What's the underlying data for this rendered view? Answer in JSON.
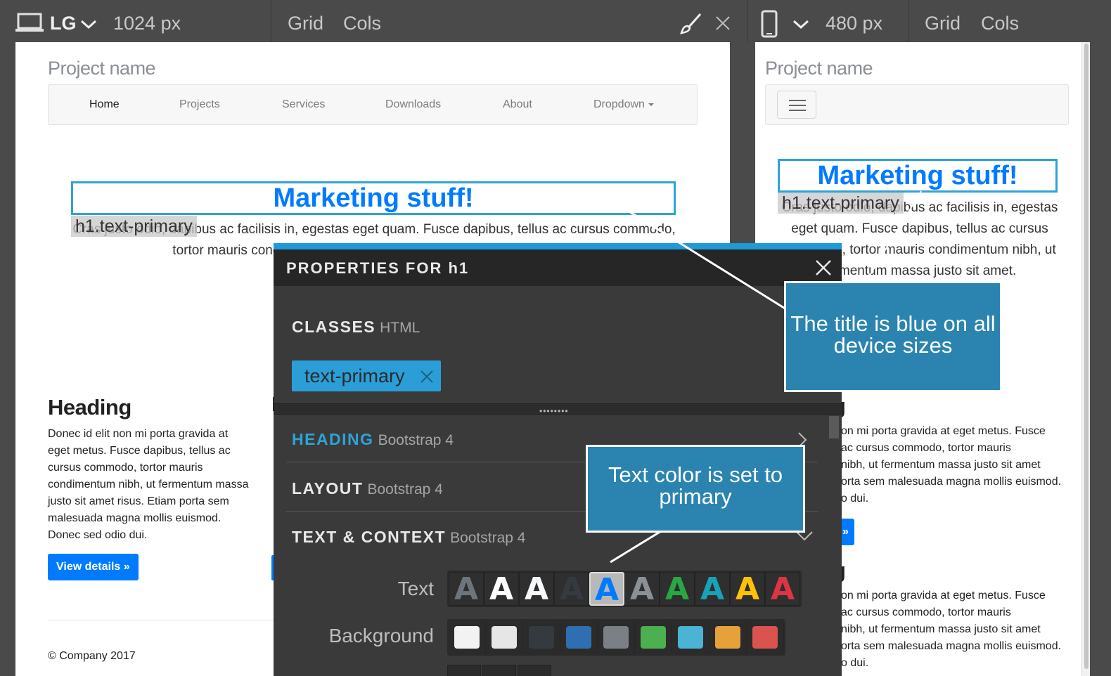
{
  "toolbar": {
    "left_device": "LG",
    "left_width": "1024 px",
    "left_grid": "Grid",
    "left_cols": "Cols",
    "right_width": "480 px",
    "right_grid": "Grid",
    "right_cols": "Cols"
  },
  "site": {
    "project_name": "Project name",
    "nav": [
      "Home",
      "Projects",
      "Services",
      "Downloads",
      "About",
      "Dropdown"
    ],
    "h1": "Marketing stuff!",
    "h1_tag": "h1.text-primary",
    "lead_left_line1": "Cras justo odio, dapibus ac facilisis in, egestas eget quam. Fusce dapibus, tellus ac cursus commodo,",
    "lead_left_line2": "tortor mauris condimentum nibh, ut fermentum massa justo sit amet.",
    "lead_right": [
      "Cras justo odio, dapibus ac facilisis in, egestas",
      "eget quam. Fusce dapibus, tellus ac cursus",
      "commodo, tortor mauris condimentum nibh, ut",
      "fermentum massa justo sit amet."
    ],
    "heading": "Heading",
    "col_text": "Donec id elit non mi porta gravida at eget metus. Fusce dapibus, tellus ac cursus commodo, tortor mauris condimentum nibh, ut fermentum massa justo sit amet risus. Etiam porta sem malesuada magna mollis euismod. Donec sed odio dui.",
    "button": "View details »",
    "footer": "© Company 2017",
    "right_heading_frag": "g",
    "right_text_lines": [
      "on mi porta gravida at eget metus. Fusce",
      "ac cursus commodo, tortor mauris",
      "nibh, ut fermentum massa justo sit amet",
      "orta sem malesuada magna mollis euismod.",
      "o dui."
    ],
    "right_button_frag": "»"
  },
  "panel": {
    "title": "PROPERTIES FOR h1",
    "classes_label": "CLASSES",
    "classes_sub": "HTML",
    "class_chip": "text-primary",
    "sections": [
      {
        "label": "HEADING",
        "sub": "Bootstrap 4"
      },
      {
        "label": "LAYOUT",
        "sub": "Bootstrap 4"
      },
      {
        "label": "TEXT & CONTEXT",
        "sub": "Bootstrap 4"
      }
    ],
    "text_label": "Text",
    "background_label": "Background",
    "text_glyph": "A",
    "text_colors": [
      "#6c757d",
      "#ffffff",
      "#f8f9fa",
      "#343a40",
      "#007bff",
      "#8a9096",
      "#28a745",
      "#17a2b8",
      "#ffc107",
      "#dc3545"
    ],
    "selected_index": 4,
    "bg_colors": [
      "#f2f2f2",
      "#e6e6e6",
      "#353a40",
      "#2f6fb1",
      "#7b8087",
      "#4caf50",
      "#4bb3d3",
      "#e5a13a",
      "#d9534f"
    ]
  },
  "callouts": {
    "title_callout": "The title is blue on all device sizes",
    "text_callout": "Text color is set to primary"
  },
  "colors": {
    "accent": "#1e9ad6",
    "primary": "#007bff",
    "callout_bg": "#2b84b0"
  }
}
